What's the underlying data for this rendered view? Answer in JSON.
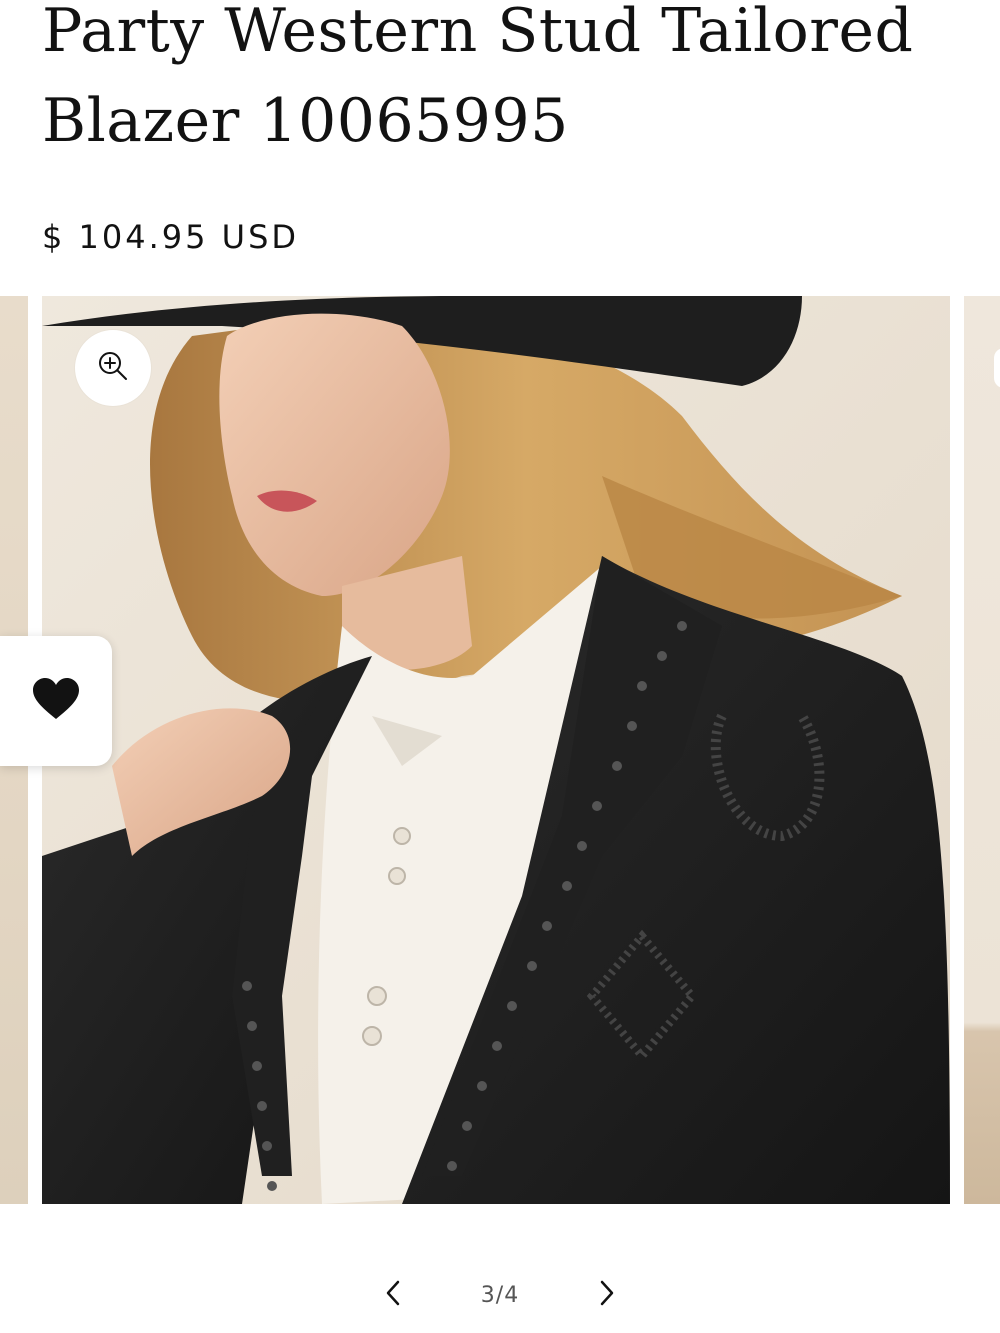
{
  "product": {
    "title": "Party Western Stud Tailored Blazer 10065995",
    "price": "$ 104.95 USD"
  },
  "gallery": {
    "image_alt": "Model wearing black studded western blazer with white shirt and black hat",
    "zoom_icon": "zoom-in-icon",
    "wishlist_icon": "heart-icon",
    "pager": {
      "prev_icon": "chevron-left-icon",
      "next_icon": "chevron-right-icon",
      "count": "3/4"
    }
  },
  "colors": {
    "text": "#121212",
    "background": "#ffffff",
    "image_background": "#ece4d8"
  }
}
